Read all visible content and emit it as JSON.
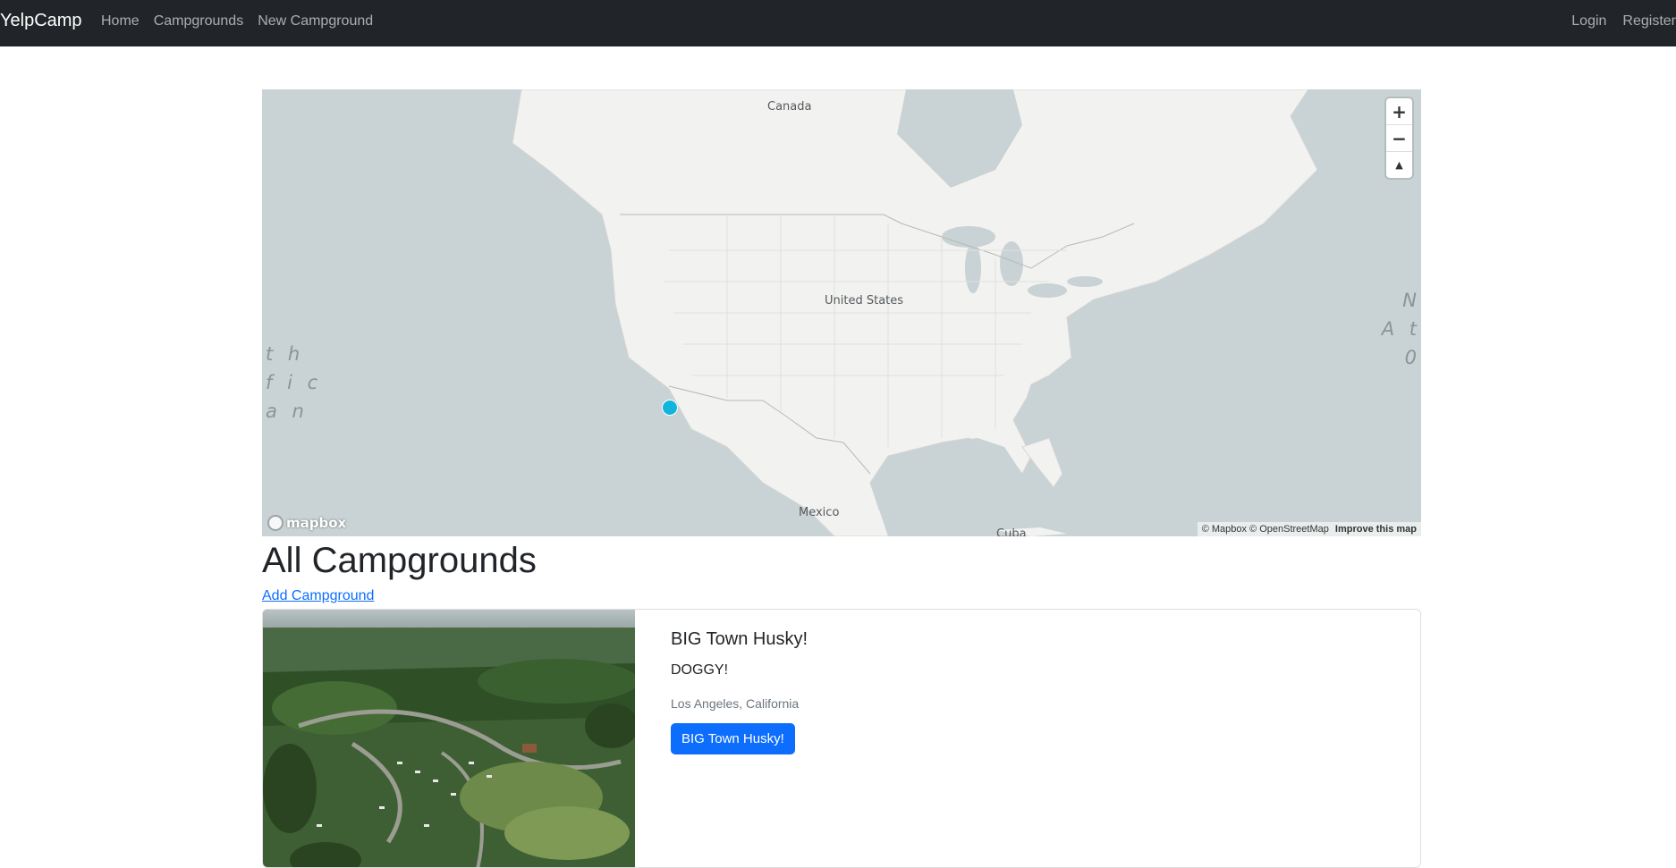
{
  "navbar": {
    "brand": "YelpCamp",
    "links": [
      "Home",
      "Campgrounds",
      "New Campground"
    ],
    "right_links": [
      "Login",
      "Register"
    ]
  },
  "map": {
    "labels": {
      "canada": "Canada",
      "united_states": "United States",
      "mexico": "Mexico",
      "cuba": "Cuba"
    },
    "ocean_left": [
      "t h",
      "f i c",
      "a n"
    ],
    "ocean_right": [
      "N",
      "A t",
      "0"
    ],
    "controls": {
      "zoom_in": "+",
      "zoom_out": "−",
      "compass": "▲"
    },
    "logo_text": "mapbox",
    "attribution": "© Mapbox © OpenStreetMap",
    "improve": "Improve this map",
    "marker_color": "#11b4da"
  },
  "main": {
    "title": "All Campgrounds",
    "add_link": "Add Campground"
  },
  "campgrounds": [
    {
      "title": "BIG Town Husky!",
      "description": "DOGGY!",
      "location": "Los Angeles, California",
      "button": "BIG Town Husky!"
    }
  ],
  "colors": {
    "navbar": "#212529",
    "primary": "#0d6efd",
    "water": "#c9d2d4",
    "land": "#f2f2f1"
  }
}
